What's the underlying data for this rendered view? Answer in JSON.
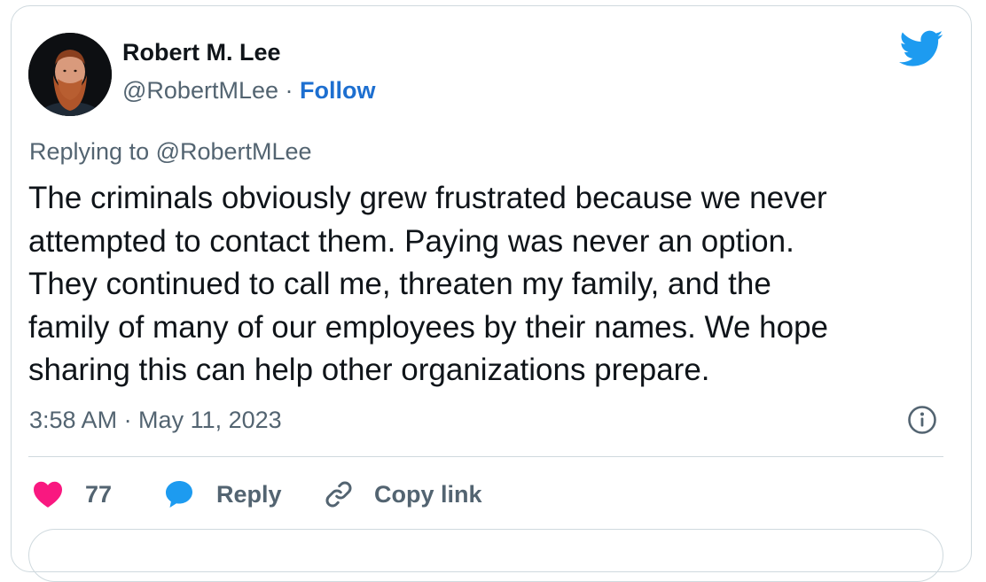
{
  "author": {
    "name": "Robert M. Lee",
    "handle": "@RobertMLee",
    "separator": "·",
    "follow_label": "Follow"
  },
  "tweet": {
    "replying_to": "Replying to @RobertMLee",
    "text": "The criminals obviously grew frustrated because we never\nattempted to contact them. Paying was never an option.\nThey continued to call me, threaten my family, and the\nfamily of many of our employees by their names. We hope\nsharing this can help other organizations prepare.",
    "timestamp": "3:58 AM · May 11, 2023"
  },
  "actions": {
    "likes_count": "77",
    "reply_label": "Reply",
    "copy_link_label": "Copy link"
  },
  "icons": {
    "brand": "twitter-bird-icon",
    "info": "info-icon",
    "like": "heart-icon",
    "reply": "speech-bubble-icon",
    "copy": "link-icon"
  },
  "colors": {
    "brand_blue": "#1d9bf0",
    "heart_pink": "#f91880",
    "muted_text": "#536471",
    "follow_blue": "#1d6fd0"
  }
}
